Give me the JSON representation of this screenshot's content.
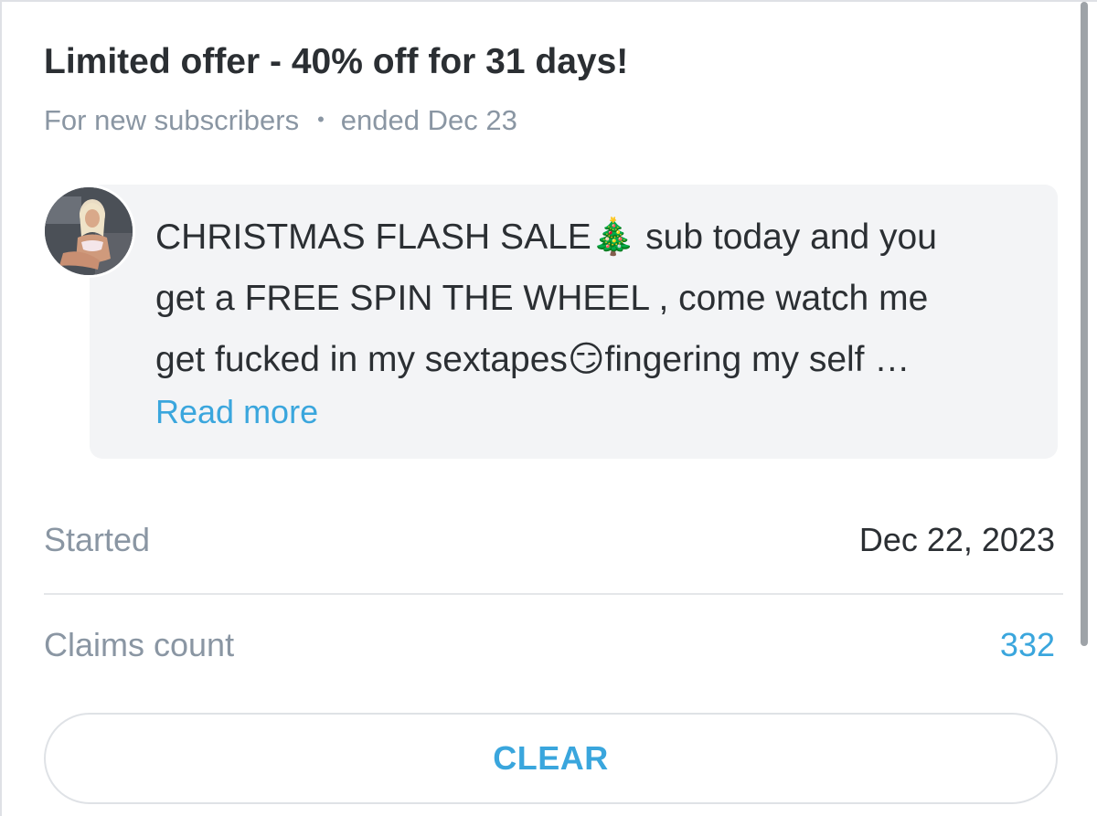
{
  "offer": {
    "title": "Limited offer - 40% off for 31 days!",
    "audience": "For new subscribers",
    "separator": "•",
    "status": "ended Dec 23"
  },
  "message": {
    "avatar_icon": "creator-avatar",
    "lines": [
      "CHRISTMAS FLASH SALE🎄 sub today and you",
      "get a FREE SPIN THE WHEEL , come watch me",
      "get fucked in my sextapes😏fingering my self …"
    ],
    "read_more": "Read more"
  },
  "details": {
    "started_label": "Started",
    "started_value": "Dec 22, 2023",
    "claims_label": "Claims count",
    "claims_value": "332"
  },
  "actions": {
    "clear_label": "CLEAR"
  },
  "colors": {
    "accent": "#3aa6dd",
    "muted": "#8a96a3",
    "text": "#2b2f33",
    "bubble": "#f3f4f6"
  }
}
